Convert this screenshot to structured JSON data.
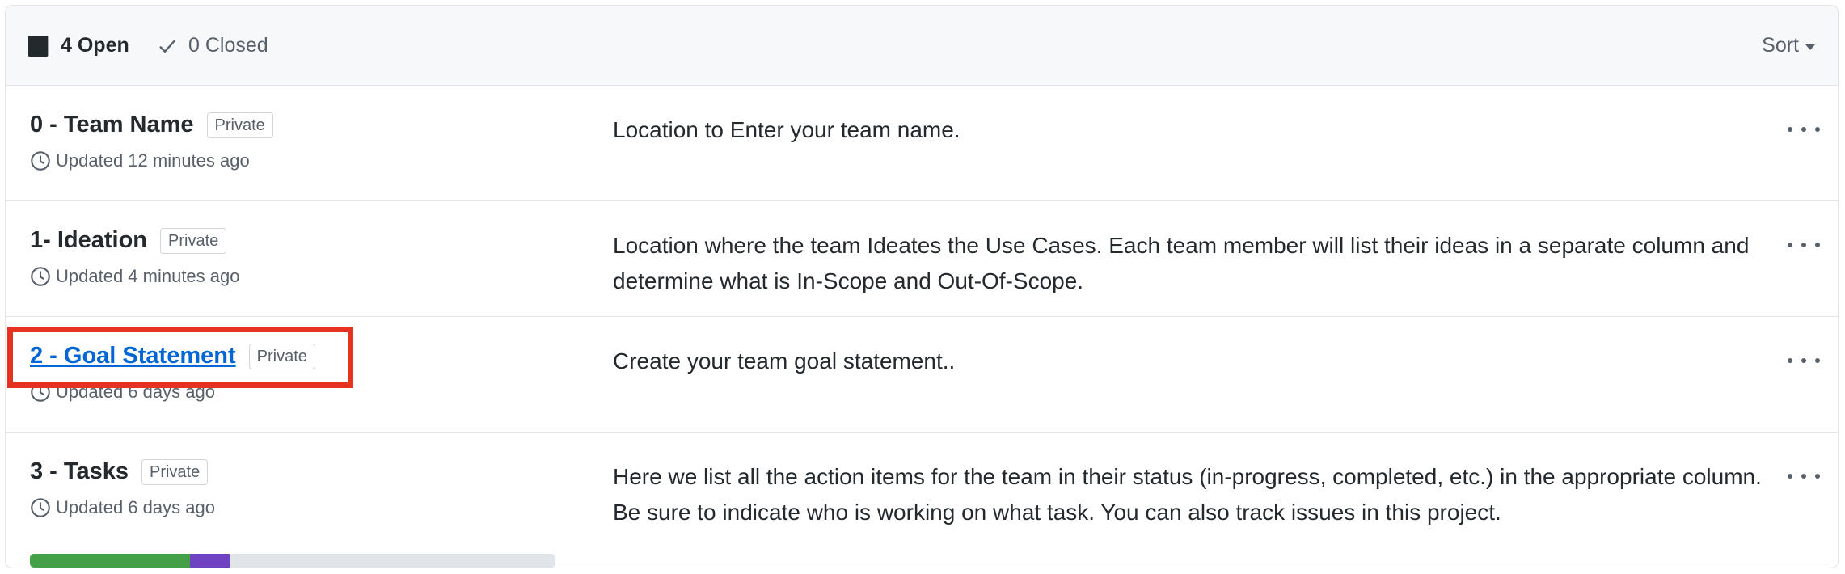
{
  "header": {
    "open_label": "4 Open",
    "closed_label": "0 Closed",
    "sort_label": "Sort"
  },
  "projects": [
    {
      "title": "0 - Team Name",
      "visibility": "Private",
      "updated": "Updated 12 minutes ago",
      "description": "Location to Enter your team name."
    },
    {
      "title": "1- Ideation",
      "visibility": "Private",
      "updated": "Updated 4 minutes ago",
      "description": "Location where the team Ideates the Use Cases. Each team member will list their ideas in a separate column and determine what is In-Scope and Out-Of-Scope."
    },
    {
      "title": "2 - Goal Statement",
      "visibility": "Private",
      "updated": "Updated 6 days ago",
      "description": "Create your team goal statement.."
    },
    {
      "title": "3 - Tasks",
      "visibility": "Private",
      "updated": "Updated 6 days ago",
      "description": "Here we list all the action items for the team in their status (in-progress, completed, etc.) in the appropriate column. Be sure to indicate who is working on what task. You can also track issues in this project.",
      "progress": {
        "done_fraction": 0.305,
        "in_progress_fraction": 0.075
      }
    }
  ],
  "icons": {
    "open": "project-board-icon",
    "closed": "check-icon",
    "updated": "clock-icon",
    "menu": "kebab-menu-icon"
  },
  "colors": {
    "link": "#0366d6",
    "progress_done": "#43a047",
    "progress_in_progress": "#6f42c1",
    "highlight": "#e5331f"
  }
}
